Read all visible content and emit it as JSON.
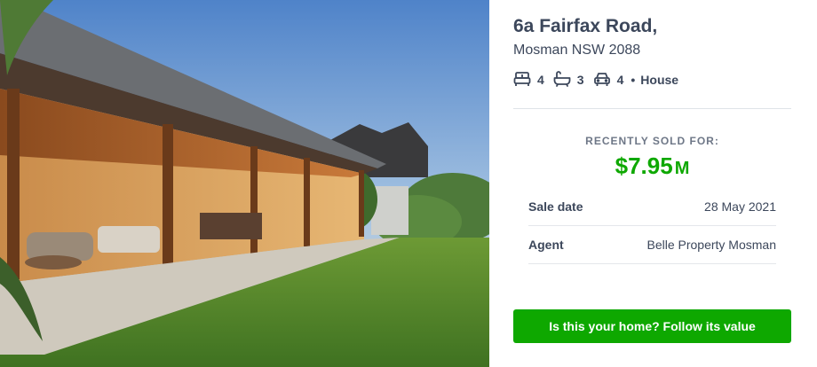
{
  "listing": {
    "address_line1": "6a Fairfax Road,",
    "address_line2": "Mosman NSW 2088",
    "features": {
      "beds": "4",
      "baths": "3",
      "parking": "4",
      "separator": "•",
      "type": "House"
    },
    "icons": [
      "bed-icon",
      "bath-icon",
      "car-icon"
    ]
  },
  "sale": {
    "label": "RECENTLY SOLD FOR:",
    "price": "$7.95",
    "price_suffix": "M",
    "price_color": "#0ea800",
    "details": [
      {
        "key": "Sale date",
        "value": "28 May 2021"
      },
      {
        "key": "Agent",
        "value": "Belle Property Mosman"
      }
    ]
  },
  "cta": {
    "label": "Is this your home? Follow its value",
    "color": "#0ea800"
  }
}
